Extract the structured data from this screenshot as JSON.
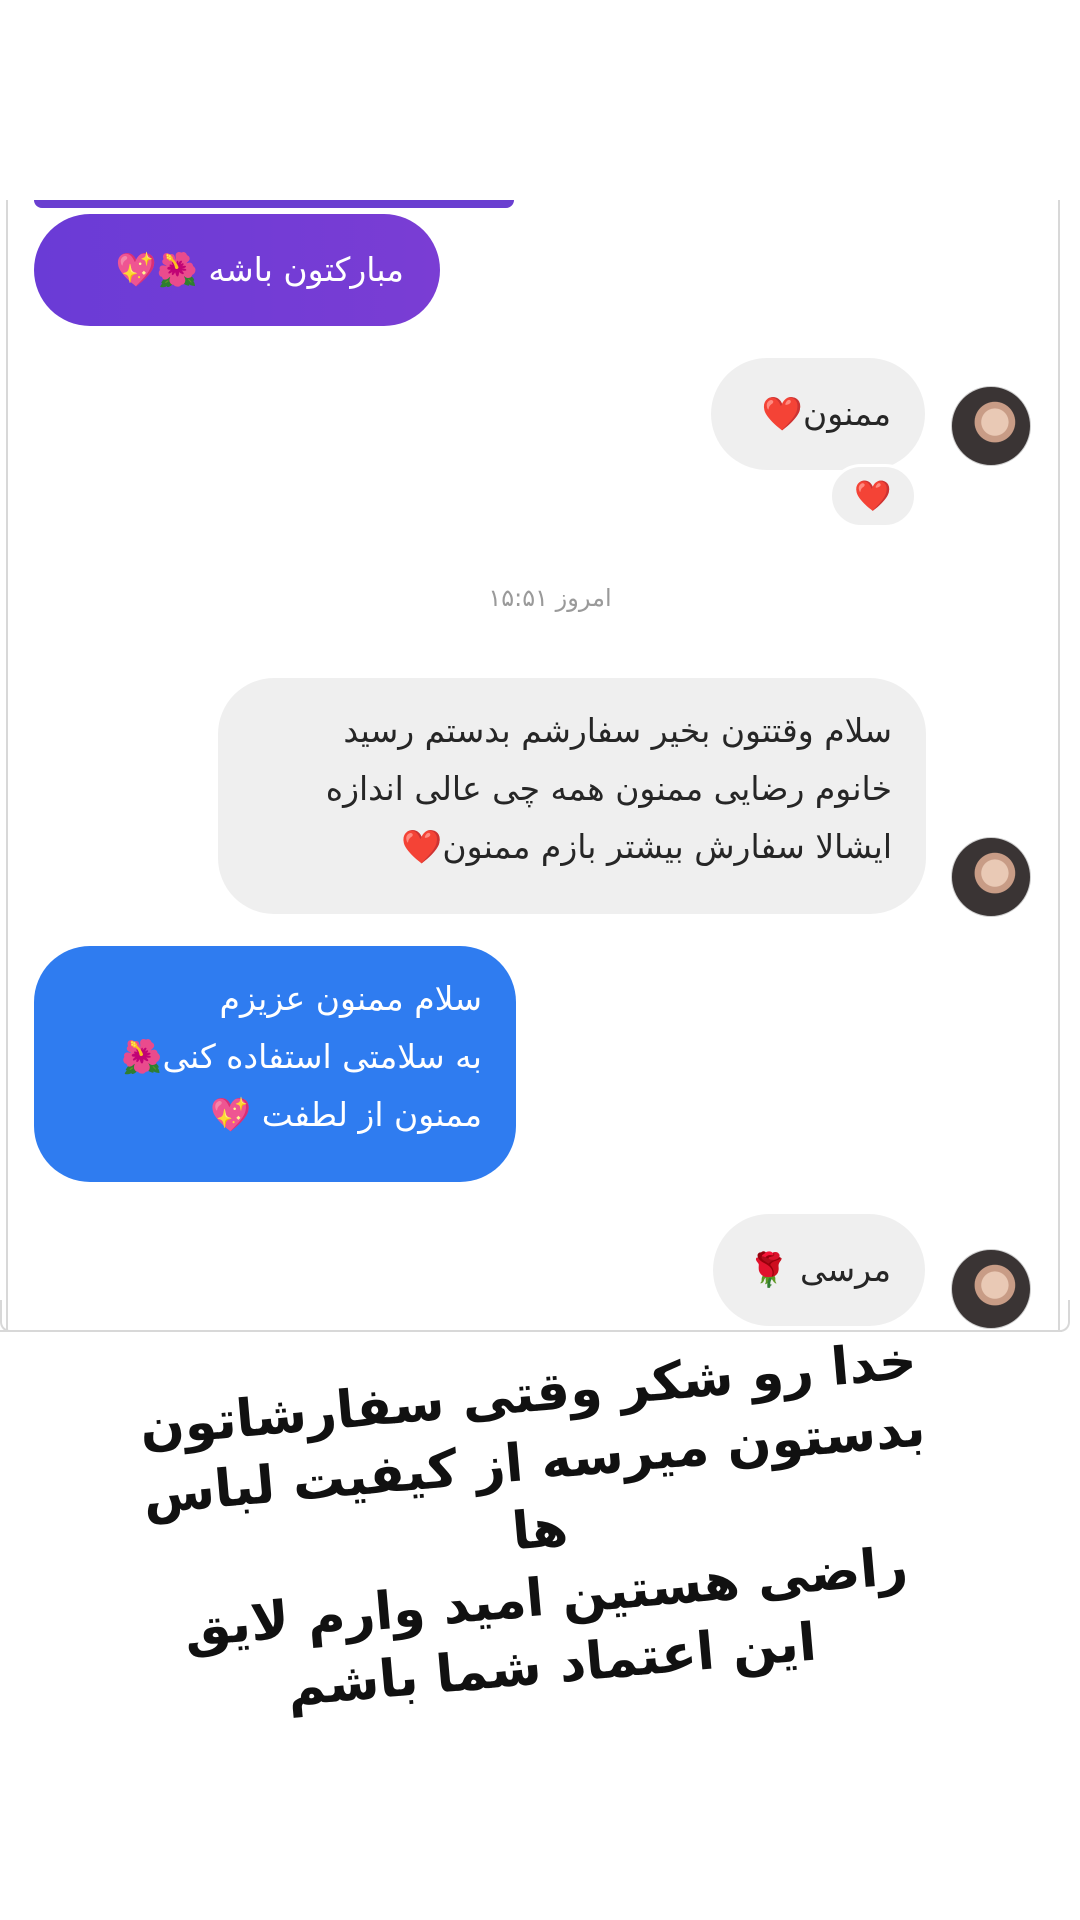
{
  "chat": {
    "msg_purple": "مبارکتون باشه 🌺💖",
    "msg_mamnoon": "ممنون❤️",
    "reaction": "❤️",
    "timestamp": "امروز ۱۵:۵۱",
    "msg_customer": "سلام وقتتون بخیر سفارشم بدستم رسید\nخانوم رضایی ممنون همه چی عالی اندازه\nایشالا سفارش بیشتر بازم ممنون❤️",
    "msg_blue": "سلام ممنون عزیزم\nبه سلامتی استفاده کنی🌺\nممنون از لطفت 💖",
    "msg_mersi": "مرسی 🌹"
  },
  "caption": {
    "text": "خدا رو شکر وقتی سفارشاتون\nبدستون میرسه از کیفیت لباس ها\nراضی هستین امید وارم لایق\nاین اعتماد شما باشم"
  },
  "colors": {
    "purple_bubble": "#6a3bd6",
    "blue_bubble": "#2f7cf0",
    "grey_bubble": "#efefef"
  }
}
